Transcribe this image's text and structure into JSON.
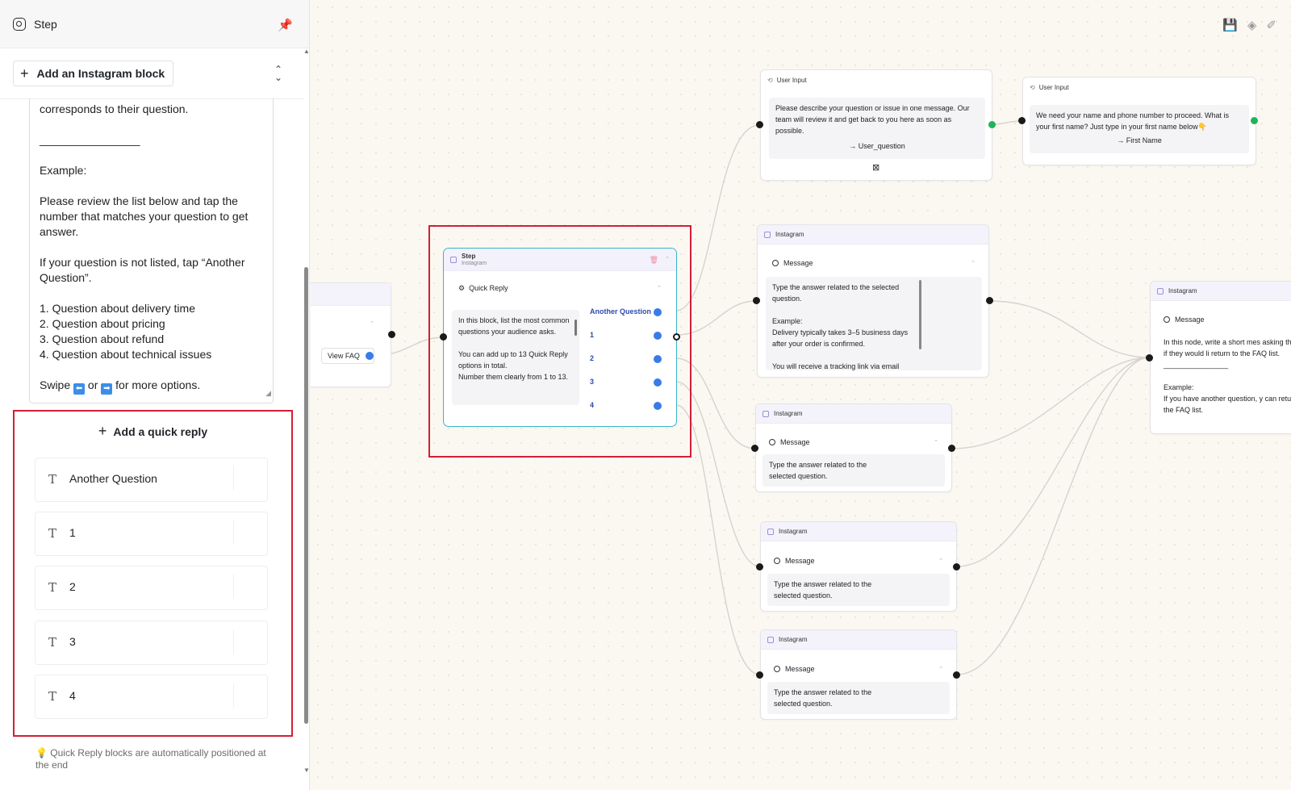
{
  "panel": {
    "title": "Step",
    "add_block_label": "Add an Instagram block",
    "textarea_lines": [
      "corresponds to their question.",
      "",
      "________________",
      "",
      "Example:",
      "",
      "Please review the list below and tap the number that matches your question to get answer.",
      "",
      "If your question is not listed, tap “Another Question”.",
      "",
      "1. Question about delivery time",
      "2. Question about pricing",
      "3. Question about refund",
      "4. Question about technical issues",
      ""
    ],
    "swipe_text": {
      "pre": "Swipe",
      "mid": "or",
      "post": "for more options."
    },
    "add_quick_reply_label": "Add a quick reply",
    "quick_replies": [
      "Another Question",
      "1",
      "2",
      "3",
      "4"
    ],
    "hint": "💡 Quick Reply blocks are automatically positioned at the end"
  },
  "canvas": {
    "partial_node": {
      "button_label": "View FAQ"
    },
    "step_node": {
      "title": "Step",
      "subtitle": "Instagram",
      "row_label": "Quick Reply",
      "body": "In this block, list the most common questions your audience asks.\n\nYou can add up to 13 Quick Reply options in total.\nNumber them clearly from 1 to 13.",
      "replies": [
        "Another Question",
        "1",
        "2",
        "3",
        "4"
      ]
    },
    "user_input_1": {
      "head": "User Input",
      "body": "Please describe your question or issue in one message. Our team will review it and get back to you here as soon as possible.",
      "variable": "User_question"
    },
    "user_input_2": {
      "head": "User Input",
      "body": "We need your name and phone number to proceed. What is your first name? Just type in your first name below👇",
      "variable": "First Name"
    },
    "msg_node_1": {
      "head": "Instagram",
      "row_label": "Message",
      "body": "Type the answer related to the selected question.\n\nExample:\nDelivery typically takes 3–5 business days after your order is confirmed.\n\nYou will receive a tracking link via email"
    },
    "msg_node_2": {
      "head": "Instagram",
      "row_label": "Message",
      "body": "Type the answer related to the selected question."
    },
    "msg_node_3": {
      "head": "Instagram",
      "row_label": "Message",
      "body": "Type the answer related to the selected question."
    },
    "msg_node_4": {
      "head": "Instagram",
      "row_label": "Message",
      "body": "Type the answer related to the selected question."
    },
    "right_node": {
      "head": "Instagram",
      "row_label": "Message",
      "body": "In this node, write a short mes asking the user if they would li return to the FAQ list.\n________________\n\nExample:\nIf you have another question, y can return to the FAQ list."
    }
  },
  "colors": {
    "highlight": "#d21f35",
    "accent_blue": "#3b7be8",
    "connector_green": "#21b35b",
    "selected_border": "#33b8c8"
  }
}
